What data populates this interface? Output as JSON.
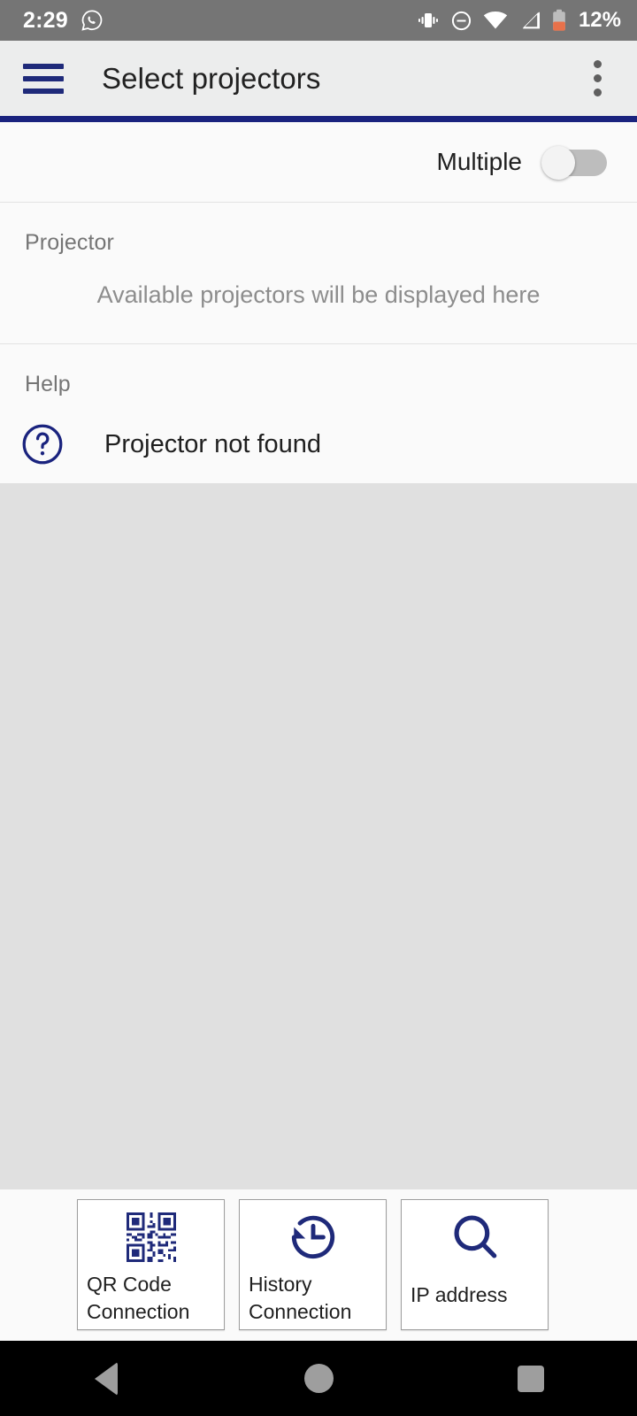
{
  "status_bar": {
    "clock": "2:29",
    "battery_percent": "12%",
    "icons": [
      "whatsapp-icon",
      "vibrate-icon",
      "do-not-disturb-icon",
      "wifi-icon",
      "cellular-signal-icon",
      "battery-low-icon"
    ],
    "background_color": "#757575",
    "text_color": "#ffffff"
  },
  "app_bar": {
    "menu_icon": "hamburger-menu-icon",
    "title": "Select projectors",
    "overflow_icon": "overflow-menu-icon",
    "background_color": "#eceded",
    "accent_color": "#1a237e"
  },
  "toggle_row": {
    "label": "Multiple",
    "state": "off"
  },
  "projector_section": {
    "title": "Projector",
    "empty_message": "Available projectors will be displayed here"
  },
  "help_section": {
    "title": "Help",
    "item_icon": "question-circle-icon",
    "item_label": "Projector not found"
  },
  "bottom_cards": [
    {
      "icon": "qr-code-icon",
      "label": "QR Code\nConnection",
      "line1": "QR Code",
      "line2": "Connection"
    },
    {
      "icon": "history-clock-icon",
      "label": "History\nConnection",
      "line1": "History",
      "line2": "Connection"
    },
    {
      "icon": "magnifier-icon",
      "label": "IP address",
      "line1": "IP address",
      "line2": ""
    }
  ],
  "nav_bar": {
    "back_label": "Back",
    "home_label": "Home",
    "recents_label": "Recents",
    "background_color": "#000000"
  },
  "theme": {
    "brand_navy": "#1a237e",
    "page_background": "#fafafa",
    "empty_area": "#e0e0e0"
  }
}
